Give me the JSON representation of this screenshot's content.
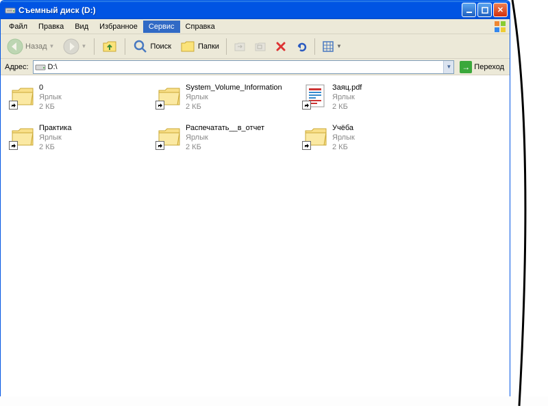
{
  "window": {
    "title": "Съемный диск (D:)"
  },
  "menu": {
    "items": [
      "Файл",
      "Правка",
      "Вид",
      "Избранное",
      "Сервис",
      "Справка"
    ],
    "active_index": 4
  },
  "toolbar": {
    "back_label": "Назад",
    "search_label": "Поиск",
    "folders_label": "Папки"
  },
  "addressbar": {
    "label": "Адрес:",
    "value": "D:\\",
    "go_label": "Переход"
  },
  "files": [
    {
      "name": "0",
      "type": "Ярлык",
      "size": "2 КБ",
      "icon": "folder"
    },
    {
      "name": "System_Volume_Information",
      "type": "Ярлык",
      "size": "2 КБ",
      "icon": "folder"
    },
    {
      "name": "Заяц.pdf",
      "type": "Ярлык",
      "size": "2 КБ",
      "icon": "pdf"
    },
    {
      "name": "Практика",
      "type": "Ярлык",
      "size": "2 КБ",
      "icon": "folder"
    },
    {
      "name": "Распечатать__в_отчет",
      "type": "Ярлык",
      "size": "2 КБ",
      "icon": "folder"
    },
    {
      "name": "Учёба",
      "type": "Ярлык",
      "size": "2 КБ",
      "icon": "folder"
    }
  ]
}
